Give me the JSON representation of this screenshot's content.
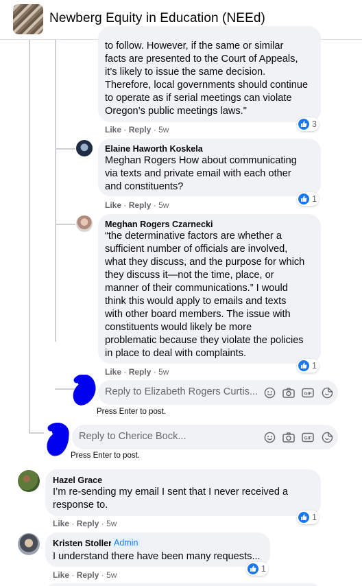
{
  "header": {
    "title": "Newberg Equity in Education (NEEd)"
  },
  "comments": {
    "top": {
      "lines": [
        "to follow. However, if the same or similar",
        "facts are presented to the Court of Appeals,",
        "it’s likely to issue the same decision.",
        "Therefore, local governments should continue",
        "to operate as if serial meetings can violate",
        "Oregon’s public meetings laws.\""
      ],
      "like": "Like",
      "reply": "Reply",
      "age": "5w",
      "reactions": "3"
    },
    "elaine": {
      "author": "Elaine Haworth Koskela",
      "lines": [
        "Meghan Rogers How about communicating",
        "via texts and private email with each other",
        "and constituents?"
      ],
      "like": "Like",
      "reply": "Reply",
      "age": "5w",
      "reactions": "1"
    },
    "meghan": {
      "author": "Meghan Rogers Czarnecki",
      "lines": [
        "“the determinative factors are whether a",
        "sufficient number of officials are involved,",
        "what they discuss, and the purpose for which",
        "they discuss it—not the time, place, or",
        "manner of their communications.” I would",
        "think this would apply to emails and texts",
        "with other board members. The issue with",
        "constituents would likely be more",
        "problematic because they violate the policies",
        "in place to deal with complaints."
      ],
      "like": "Like",
      "reply": "Reply",
      "age": "5w",
      "reactions": "1"
    },
    "hazel": {
      "author": "Hazel Grace",
      "lines": [
        "I’m re-sending my email I sent that I never received a",
        "response to."
      ],
      "like": "Like",
      "reply": "Reply",
      "age": "5w",
      "reactions": "1"
    },
    "kristen": {
      "author": "Kristen Stoller",
      "badge": "Admin",
      "lines": [
        "I understand there have been many requests..."
      ],
      "like": "Like",
      "reply": "Reply",
      "age": "5w",
      "reactions": "1"
    }
  },
  "reply_boxes": {
    "elizabeth": {
      "placeholder": "Reply to Elizabeth Rogers Curtis...",
      "hint": "Press Enter to post."
    },
    "cherice": {
      "placeholder": "Reply to Cherice Bock...",
      "hint": "Press Enter to post."
    }
  },
  "separator": "·",
  "icons": [
    "emoji-icon",
    "camera-icon",
    "gif-icon",
    "sticker-icon",
    "like-reaction-icon"
  ],
  "colors": {
    "accent": "#1877f2",
    "bubble": "#f0f2f5",
    "muted": "#65676b",
    "scribble": "#0000ee"
  }
}
